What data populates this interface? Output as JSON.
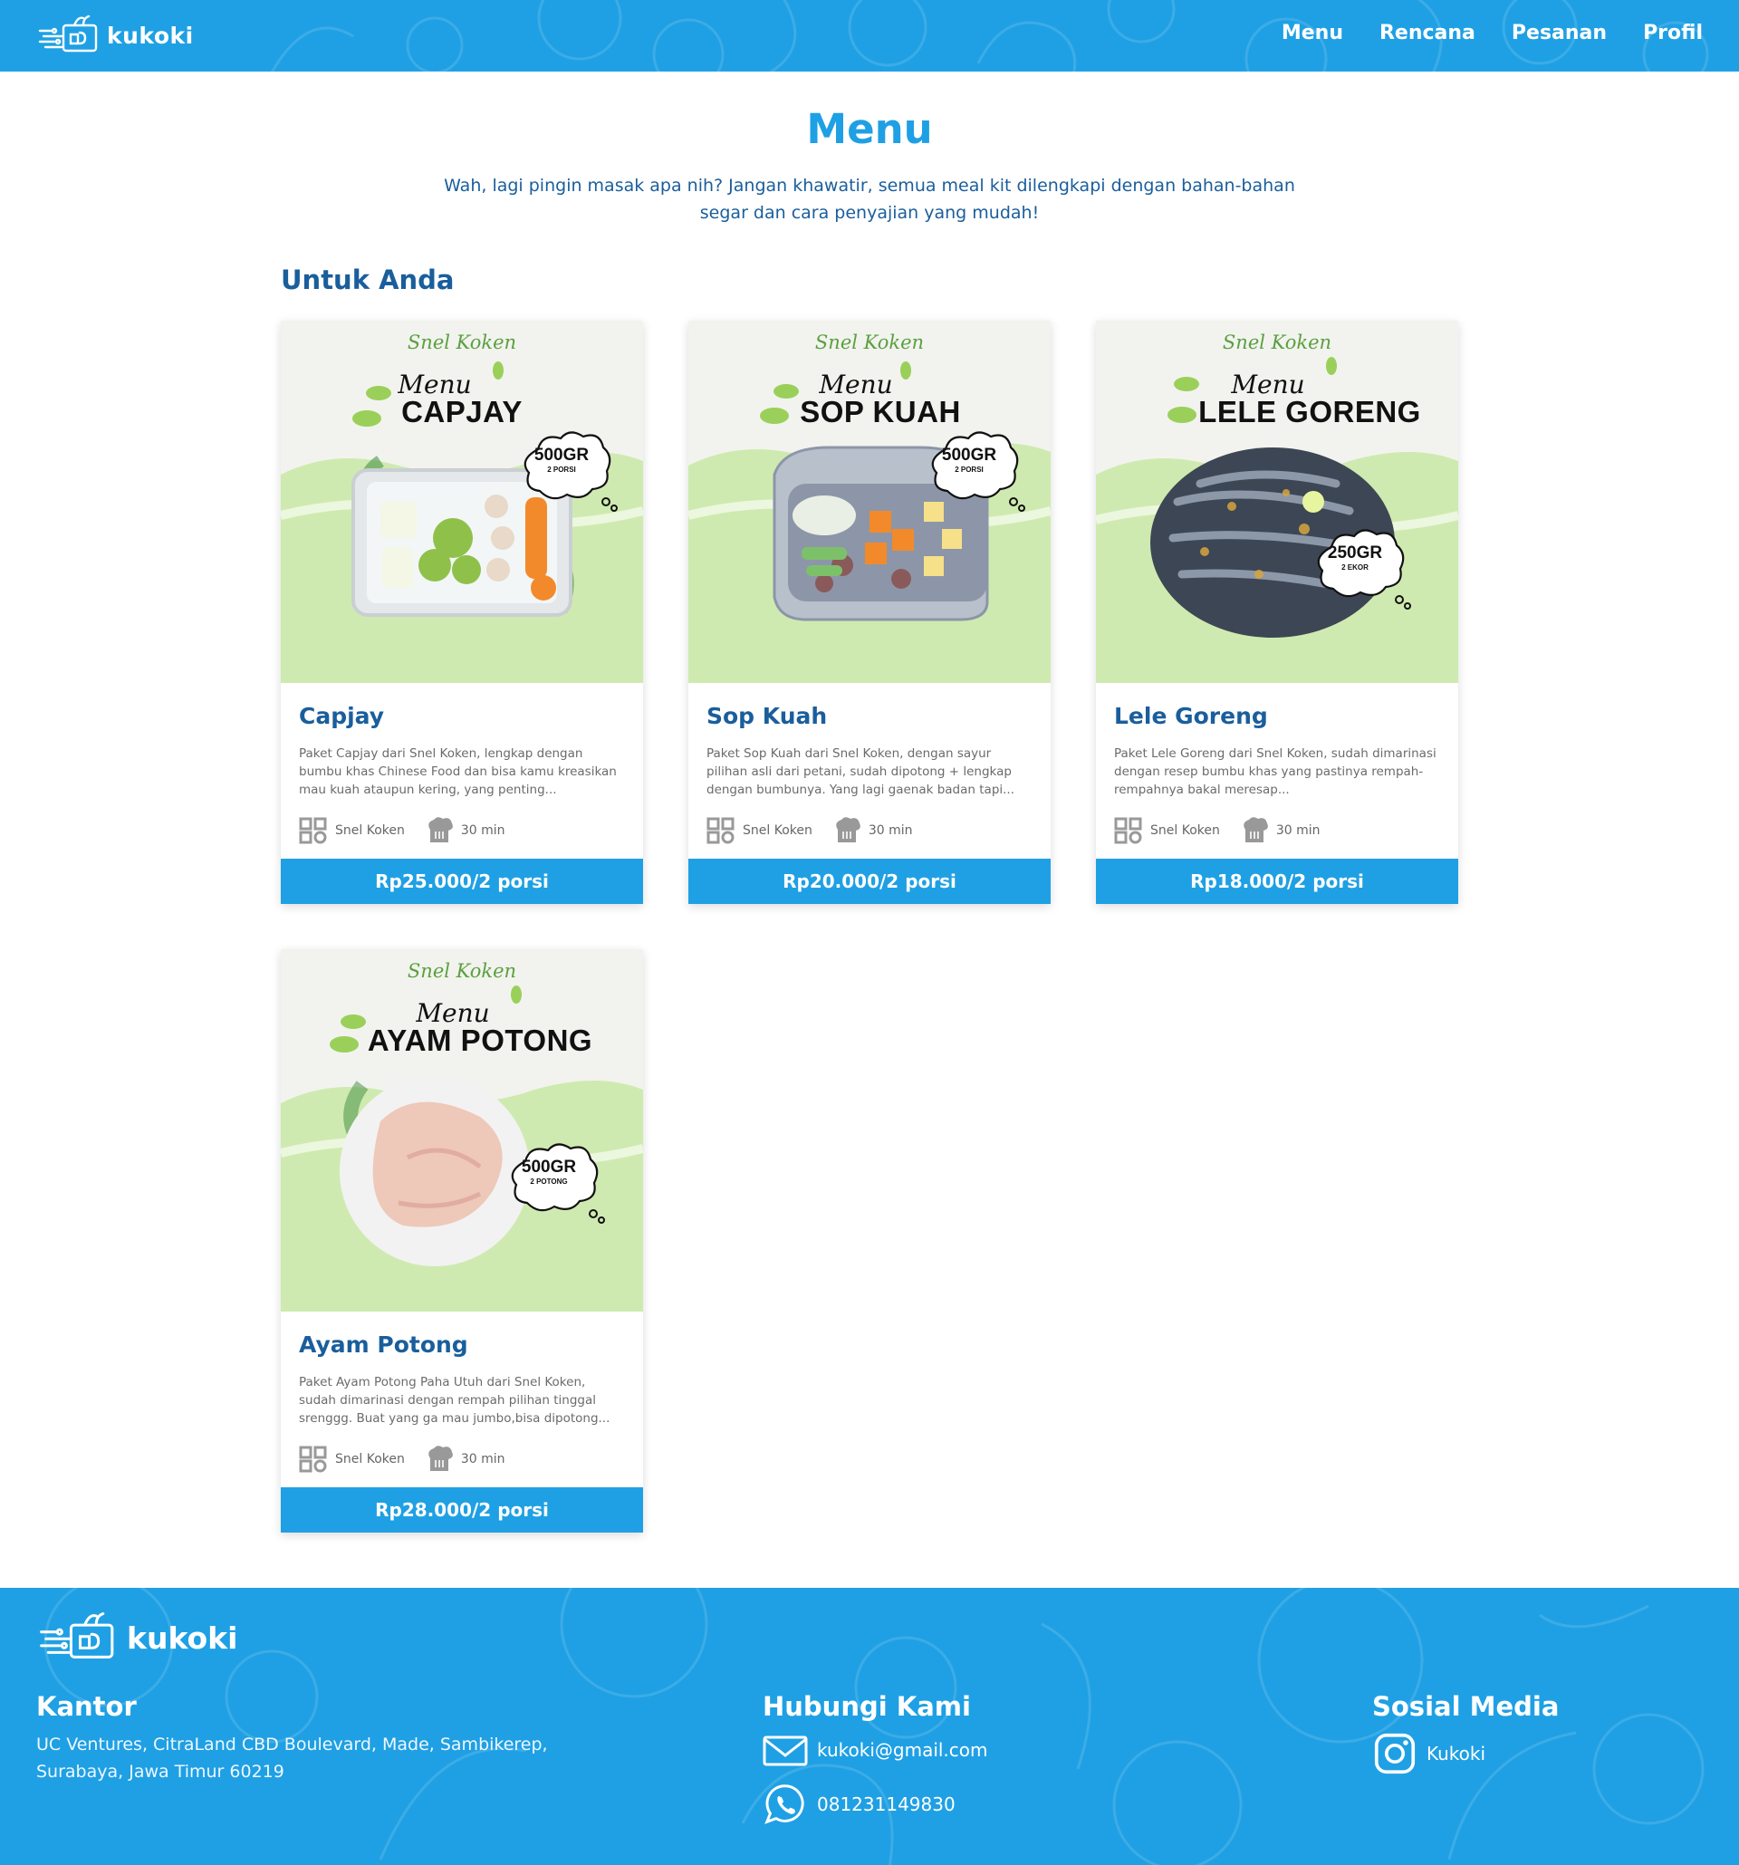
{
  "header": {
    "brand": "kukoki",
    "nav": [
      "Menu",
      "Rencana",
      "Pesanan",
      "Profil"
    ]
  },
  "page": {
    "title": "Menu",
    "intro_line1": "Wah, lagi pingin masak apa nih? Jangan khawatir, semua meal kit dilengkapi dengan bahan-bahan",
    "intro_line2": "segar dan cara penyajian yang mudah!",
    "section_title": "Untuk Anda"
  },
  "products": [
    {
      "img_brand": "Snel Koken",
      "img_menu": "Menu",
      "img_name": "CAPJAY",
      "img_weight": "500GR",
      "img_portion": "2 PORSI",
      "title": "Capjay",
      "desc": "Paket Capjay dari Snel Koken, lengkap dengan bumbu khas Chinese Food dan bisa kamu kreasikan mau kuah ataupun kering, yang penting...",
      "vendor": "Snel Koken",
      "time": "30 min",
      "price": "Rp25.000/2 porsi",
      "food_color": "#f3f6f7"
    },
    {
      "img_brand": "Snel Koken",
      "img_menu": "Menu",
      "img_name": "SOP KUAH",
      "img_weight": "500GR",
      "img_portion": "2 PORSI",
      "title": "Sop Kuah",
      "desc": "Paket Sop Kuah dari Snel Koken, dengan sayur pilihan asli dari petani, sudah dipotong + lengkap dengan bumbunya. Yang lagi gaenak badan tapi...",
      "vendor": "Snel Koken",
      "time": "30 min",
      "price": "Rp20.000/2 porsi",
      "food_color": "#8c96a8"
    },
    {
      "img_brand": "Snel Koken",
      "img_menu": "Menu",
      "img_name": "LELE GORENG",
      "img_weight": "250GR",
      "img_portion": "2 EKOR",
      "title": "Lele Goreng",
      "desc": "Paket Lele Goreng dari Snel Koken, sudah dimarinasi dengan resep bumbu khas yang pastinya rempah-rempahnya bakal meresap...",
      "vendor": "Snel Koken",
      "time": "30 min",
      "price": "Rp18.000/2 porsi",
      "food_color": "#3d4654"
    },
    {
      "img_brand": "Snel Koken",
      "img_menu": "Menu",
      "img_name": "AYAM POTONG",
      "img_weight": "500GR",
      "img_portion": "2 POTONG",
      "title": "Ayam Potong",
      "desc": "Paket Ayam Potong Paha Utuh dari Snel Koken, sudah dimarinasi dengan rempah pilihan tinggal srenggg. Buat yang ga mau jumbo,bisa dipotong...",
      "vendor": "Snel Koken",
      "time": "30 min",
      "price": "Rp28.000/2 porsi",
      "food_color": "#eec8b8"
    }
  ],
  "footer": {
    "brand": "kukoki",
    "office_title": "Kantor",
    "office_addr_line1": "UC Ventures, CitraLand CBD Boulevard, Made, Sambikerep,",
    "office_addr_line2": "Surabaya, Jawa Timur 60219",
    "contact_title": "Hubungi Kami",
    "email": "kukoki@gmail.com",
    "phone": "081231149830",
    "social_title": "Sosial Media",
    "instagram": "Kukoki"
  },
  "colors": {
    "primary": "#1fa0e4",
    "heading": "#1a5e9c",
    "text_muted": "#6b6b6b",
    "card_green": "#cfeab0"
  },
  "icons": {
    "vendor": "grid-icon",
    "time": "chef-hat-icon",
    "email": "envelope-icon",
    "phone": "whatsapp-icon",
    "social": "instagram-icon"
  }
}
